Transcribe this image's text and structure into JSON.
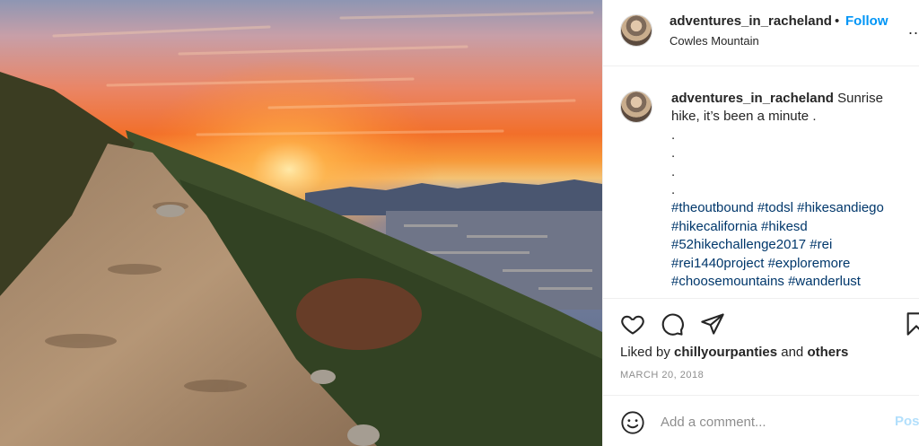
{
  "post": {
    "username": "adventures_in_racheland",
    "separator": "•",
    "follow_label": "Follow",
    "location": "Cowles Mountain",
    "more_label": "..",
    "caption_username": "adventures_in_racheland",
    "caption_text_1": "Sunrise",
    "caption_text_2": "hike, it’s been a minute .",
    "caption_dots": [
      ".",
      ".",
      ".",
      "."
    ],
    "hashtag_lines": [
      "#theoutbound #todsl #hikesandiego",
      "#hikecalifornia #hikesd",
      "#52hikechallenge2017 #rei",
      "#rei1440project #exploremore",
      "#choosemountains #wanderlust"
    ],
    "liked_by_prefix": "Liked by",
    "liked_by_user": "chillyourpanties",
    "liked_by_and": "and",
    "liked_by_others": "others",
    "date": "MARCH 20, 2018",
    "comment_placeholder": "Add a comment...",
    "post_label": "Pos"
  },
  "icons": {
    "like": "heart-icon",
    "comment": "comment-icon",
    "share": "paper-plane-icon",
    "save": "bookmark-icon",
    "emoji": "smiley-icon"
  },
  "colors": {
    "link_blue": "#0095f6",
    "hashtag": "#00376b",
    "muted": "#8e8e8e",
    "post_disabled": "#b2dffc"
  }
}
